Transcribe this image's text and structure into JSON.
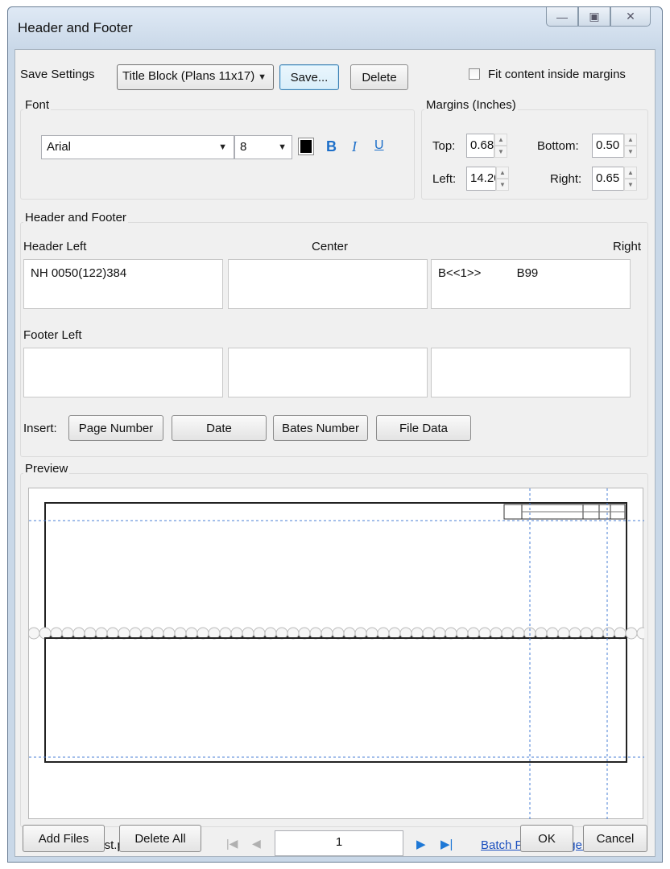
{
  "window": {
    "title": "Header and Footer"
  },
  "save_settings": {
    "label": "Save Settings",
    "selected": "Title Block (Plans 11x17)",
    "save_button": "Save...",
    "delete_button": "Delete",
    "fit_label": "Fit content inside margins",
    "fit_checked": false
  },
  "font": {
    "label": "Font",
    "family": "Arial",
    "size": "8",
    "color": "#000000",
    "bold": "B",
    "italic": "I",
    "underline": "U"
  },
  "margins": {
    "label": "Margins (Inches)",
    "top_label": "Top:",
    "top": "0.68",
    "bottom_label": "Bottom:",
    "bottom": "0.50",
    "left_label": "Left:",
    "left": "14.20",
    "right_label": "Right:",
    "right": "0.65"
  },
  "header_footer": {
    "group_label": "Header and Footer",
    "header_left_label": "Header Left",
    "center_label": "Center",
    "right_label": "Right",
    "header_left": "NH 0050(122)384",
    "header_center": "",
    "header_right_1": "B<<1>>",
    "header_right_2": "B99",
    "footer_left_label": "Footer Left",
    "footer_left": "",
    "footer_center": "",
    "footer_right": ""
  },
  "insert": {
    "label": "Insert:",
    "page_number": "Page Number",
    "date": "Date",
    "bates_number": "Bates Number",
    "file_data": "File Data"
  },
  "preview": {
    "label": "Preview"
  },
  "navigation": {
    "file_name": "Blank Sheet Test.pdf",
    "page": "1",
    "batch_link": "Batch Page Range (1-8)"
  },
  "footer_buttons": {
    "add_files": "Add Files",
    "delete_all": "Delete All",
    "ok": "OK",
    "cancel": "Cancel"
  }
}
